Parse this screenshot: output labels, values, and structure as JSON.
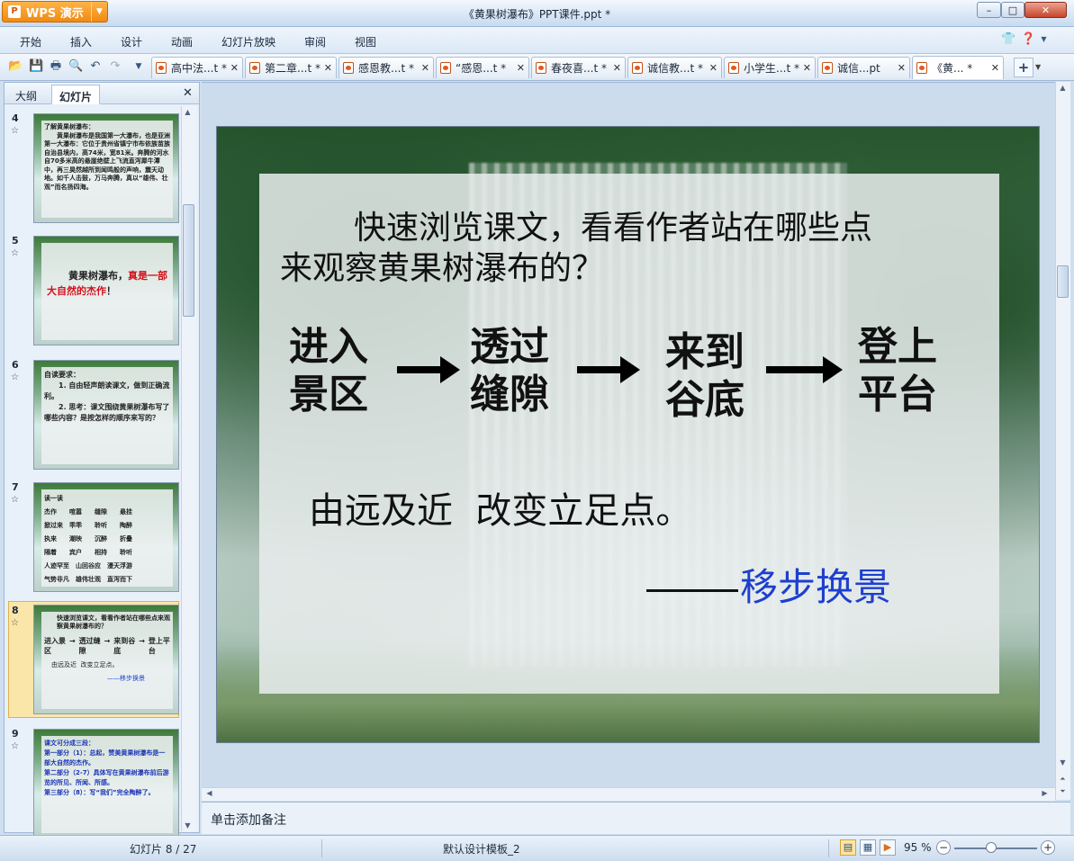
{
  "app": {
    "name": "WPS 演示",
    "window_title": "《黄果树瀑布》PPT课件.ppt *"
  },
  "window_controls": {
    "minimize": "–",
    "maximize": "□",
    "close": "✕"
  },
  "menu": {
    "items": [
      "开始",
      "插入",
      "设计",
      "动画",
      "幻灯片放映",
      "审阅",
      "视图"
    ],
    "right_icons": [
      "skin-icon",
      "help-icon"
    ]
  },
  "doc_tabs": [
    {
      "label": "高中法...t *",
      "active": false
    },
    {
      "label": "第二章...t *",
      "active": false
    },
    {
      "label": "感恩教...t *",
      "active": false
    },
    {
      "label": "“感恩...t *",
      "active": false
    },
    {
      "label": "春夜喜...t *",
      "active": false
    },
    {
      "label": "诚信教...t *",
      "active": false
    },
    {
      "label": "小学生...t *",
      "active": false
    },
    {
      "label": "诚信...pt",
      "active": false
    },
    {
      "label": "《黄... *",
      "active": true
    }
  ],
  "left_panel": {
    "tabs": [
      "大纲",
      "幻灯片"
    ],
    "active_tab": "幻灯片",
    "slides": [
      {
        "number": "4",
        "text": "了解黄果树瀑布：\n　　黄果树瀑布是我国第一大瀑布，也是亚洲第一大瀑布：它位于贵州省镇宁市布依族苗族自治县境内，高74米，宽81米。奔腾的河水自70多米高的悬崖绝壁上飞流直泻犀牛潭中，再三昊然越所到闻鸣般的声响，震天动地。如千人击鼓，万马奔腾，真以“雄伟、壮观”而名扬四海。"
      },
      {
        "number": "5",
        "text_plain": "黄果树瀑布，",
        "text_red": "真是一部大自然的杰作",
        "text_end": "！"
      },
      {
        "number": "6",
        "text": "自读要求：\n　　1. 自由轻声朗读课文，做到正确流利。\n　　2. 思考：课文围绕黄果树瀑布写了哪些内容？是按怎样的顺序来写的？"
      },
      {
        "number": "7",
        "text": "读一读\n杰作　　喧嚣　　缝隙　　悬挂\n掀过来　乖乖　　聆听　　陶醉\n执来　　潮映　　沉醉　　折叠\n隔着　　宾户　　相持　　聆听\n人迹罕至　山回谷应　漫天浮游\n气势非凡　雄伟壮观　直泻而下"
      },
      {
        "number": "8",
        "text": "快速浏览课文，看看作者站在哪些点来观察黄果树瀑布的？",
        "flow": [
          "进入景区",
          "透过缝隙",
          "来到谷底",
          "登上平台"
        ],
        "summary": "由远及近  改变立足点。",
        "moral": "——移步换景",
        "selected": true
      },
      {
        "number": "9",
        "text": "课文可分成三段：\n第一部分（1）：总起，赞美黄果树瀑布是一部大自然的杰作。\n第二部分（2-7）具体写在黄果树瀑布前后游览的所见、所闻、所感。\n第三部分（8）：写“我们”完全陶醉了。"
      }
    ]
  },
  "slide": {
    "question_indent": "快速浏览课文，看看作者站在哪些点",
    "question_rest": "来观察黄果树瀑布的？",
    "flow": [
      {
        "line1": "进入",
        "line2": "景区"
      },
      {
        "line1": "透过",
        "line2": "缝隙"
      },
      {
        "line1": "来到",
        "line2": "谷底"
      },
      {
        "line1": "登上",
        "line2": "平台"
      }
    ],
    "summary": "由远及近  改变立足点。",
    "moral": "移步换景",
    "colors": {
      "moral": "#1d3fcf",
      "highlight_red": "#d4101a"
    }
  },
  "notes": {
    "placeholder": "单击添加备注"
  },
  "status": {
    "slide_counter": "幻灯片 8 / 27",
    "template": "默认设计模板_2",
    "zoom": "95 %",
    "zoom_level_fraction": 0.45
  }
}
